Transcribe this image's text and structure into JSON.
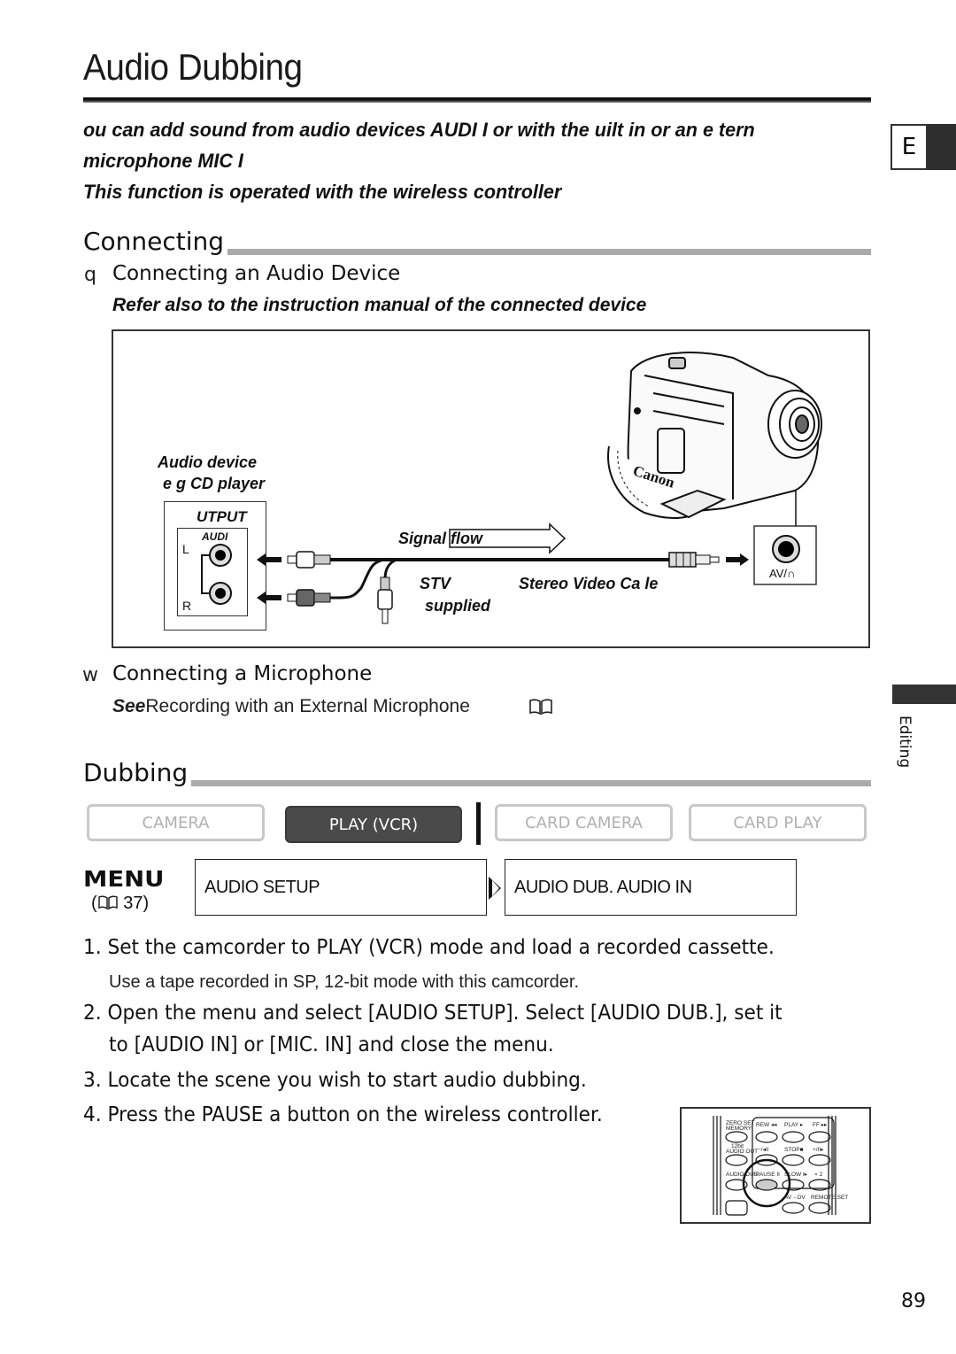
{
  "page": {
    "title": "Audio Dubbing",
    "language_tab": "E",
    "side_section": "Editing",
    "page_number": "89"
  },
  "intro": {
    "line1": "ou can add sound from audio devices  AUDI    I     or with the   uilt in or an e  tern",
    "line2": "microphone  MIC  I",
    "line3": "This function is operated with the wireless controller"
  },
  "connecting": {
    "title": "Connecting",
    "audio_device": {
      "marker": "q",
      "title": "Connecting an Audio Device",
      "note": "Refer also to the instruction manual of the connected device"
    },
    "diagram": {
      "device_label_1": "Audio device",
      "device_label_2": "e g  CD player",
      "output_label": "UTPUT",
      "audio_label": "AUDI",
      "left_label": "L",
      "right_label": "R",
      "signal_flow": "Signal flow",
      "cable_code": "STV",
      "cable_name": "Stereo Video Ca  le",
      "cable_supplied": "supplied",
      "camera_brand": "Canon",
      "av_jack_label": "AV/∩"
    },
    "microphone": {
      "marker": "w",
      "title": "Connecting a Microphone",
      "see_bold": "See",
      "see_text": "Recording with an External Microphone",
      "book_icon": "🕮"
    }
  },
  "dubbing": {
    "title": "Dubbing",
    "modes": [
      {
        "label": "CAMERA",
        "active": false
      },
      {
        "label": "PLAY (VCR)",
        "active": true
      },
      {
        "label": "CARD CAMERA",
        "active": false
      },
      {
        "label": "CARD PLAY",
        "active": false
      }
    ],
    "menu": {
      "word": "MENU",
      "ref": "(  37)",
      "item1": "AUDIO SETUP",
      "item2": "AUDIO DUB.   AUDIO IN"
    },
    "steps": [
      {
        "text": "1. Set the camcorder to PLAY (VCR) mode and load a recorded cassette.",
        "note": "Use a tape recorded in SP, 12-bit mode with this camcorder."
      },
      {
        "text": "2. Open the menu and select [AUDIO SETUP]. Select [AUDIO DUB.], set it",
        "text2": "to [AUDIO IN] or [MIC. IN] and close the menu."
      },
      {
        "text": "3. Locate the scene you wish to start audio dubbing."
      },
      {
        "text": "4. Press the PAUSE a  button on the wireless controller."
      }
    ],
    "remote": {
      "labels": [
        "ZERO SET MEMORY",
        "REW ◂◂",
        "PLAY ▸",
        "FF ▸▸",
        "12bit AUDIO OUT",
        "−/◂II",
        "STOP■",
        "+/II▸",
        "AUDIO DUB.",
        "PAUSE II",
        "SLOW I▸",
        "× 2",
        "AV→DV",
        "REMOTE SET"
      ]
    }
  }
}
